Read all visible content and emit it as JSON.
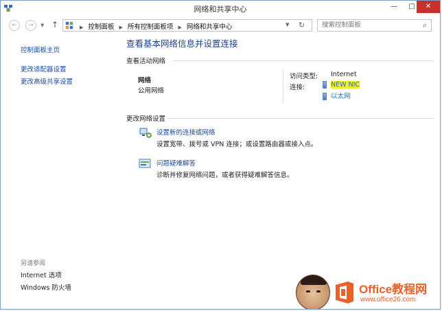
{
  "window": {
    "title": "网络和共享中心",
    "min_label": "—",
    "max_label": "□",
    "close_label": "✕"
  },
  "address": {
    "breadcrumbs": [
      "控制面板",
      "所有控制面板项",
      "网络和共享中心"
    ],
    "search_placeholder": "搜索控制面板"
  },
  "sidebar": {
    "items": [
      {
        "label": "控制面板主页"
      },
      {
        "label": "更改适配器设置"
      },
      {
        "label": "更改高级共享设置"
      }
    ],
    "see_also_label": "另请参阅",
    "see_also": [
      {
        "label": "Internet 选项"
      },
      {
        "label": "Windows 防火墙"
      }
    ]
  },
  "main": {
    "heading": "查看基本网络信息并设置连接",
    "active_section": "查看活动网络",
    "network": {
      "name": "网络",
      "type": "公用网络",
      "access_label": "访问类型:",
      "access_value": "Internet",
      "conn_label": "连接:",
      "connections": [
        "NEW NIC",
        "以太网"
      ]
    },
    "change_section": "更改网络设置",
    "tasks": [
      {
        "title": "设置新的连接或网络",
        "desc": "设置宽带、拨号或 VPN 连接；或设置路由器或接入点。",
        "icon": "network-setup-icon"
      },
      {
        "title": "问题疑难解答",
        "desc": "诊断并修复网络问题，或者获得疑难解答信息。",
        "icon": "troubleshoot-icon"
      }
    ]
  },
  "watermark": {
    "title": "Office教程网",
    "url": "www.office26.com"
  },
  "colors": {
    "link": "#1a4ba0",
    "heading": "#1e3f8a",
    "highlight": "#f5ec2a",
    "close": "#c7312b",
    "watermark": "#e8602a"
  }
}
